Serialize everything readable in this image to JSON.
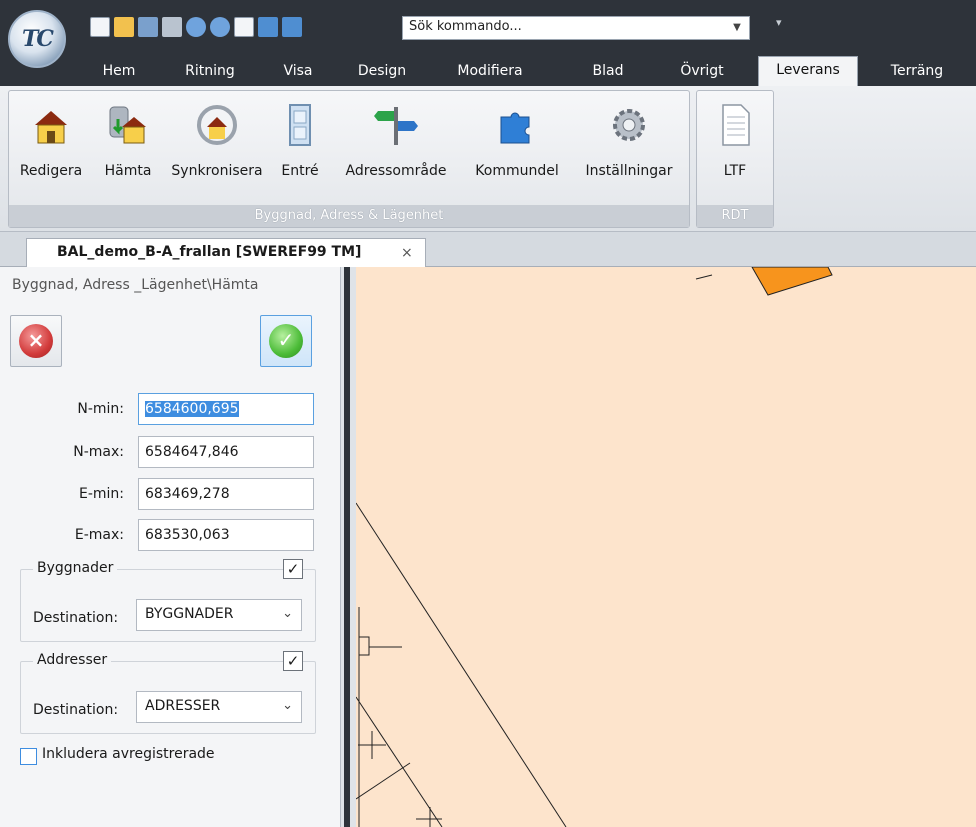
{
  "app": {
    "logo_text": "TC"
  },
  "quick_access": {
    "search_placeholder": "Sök kommando..."
  },
  "tabs": [
    "Hem",
    "Ritning",
    "Visa",
    "Design",
    "Modifiera",
    "Blad",
    "Övrigt",
    "Leverans",
    "Terräng"
  ],
  "active_tab": "Leverans",
  "ribbon": {
    "groups": [
      {
        "label": "Byggnad, Adress & Lägenhet",
        "buttons": [
          "Redigera",
          "Hämta",
          "Synkronisera",
          "Entré",
          "Adressområde",
          "Kommundel",
          "Inställningar"
        ]
      },
      {
        "label": "RDT",
        "buttons": [
          "LTF"
        ]
      }
    ]
  },
  "document_tab": {
    "label": "BAL_demo_B-A_frallan [SWEREF99 TM]",
    "close": "×"
  },
  "panel": {
    "breadcrumb": "Byggnad, Adress _Lägenhet\\Hämta",
    "fields": [
      {
        "label": "N-min:",
        "value": "6584600,695"
      },
      {
        "label": "N-max:",
        "value": "6584647,846"
      },
      {
        "label": "E-min:",
        "value": "683469,278"
      },
      {
        "label": "E-max:",
        "value": "683530,063"
      }
    ],
    "byggnader": {
      "title": "Byggnader",
      "checked": true,
      "dest_label": "Destination:",
      "dest_value": "BYGGNADER"
    },
    "addresser": {
      "title": "Addresser",
      "checked": true,
      "dest_label": "Destination:",
      "dest_value": "ADRESSER"
    },
    "include_unregistered": {
      "label": "Inkludera avregistrerade",
      "checked": false
    }
  },
  "colors": {
    "canvas": "#fde4cc",
    "building": "#f7941d",
    "chrome_dark": "#2e333a"
  }
}
